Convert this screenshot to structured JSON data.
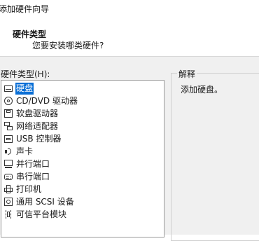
{
  "wizard": {
    "title": "添加硬件向导",
    "header_title": "硬件类型",
    "header_subtitle": "您要安装哪类硬件?"
  },
  "hardware_list": {
    "label": "硬件类型(H):",
    "selected_index": 0,
    "items": [
      {
        "label": "硬盘",
        "icon": "hard-disk-icon"
      },
      {
        "label": "CD/DVD 驱动器",
        "icon": "cd-dvd-icon"
      },
      {
        "label": "软盘驱动器",
        "icon": "floppy-icon"
      },
      {
        "label": "网络适配器",
        "icon": "network-adapter-icon"
      },
      {
        "label": "USB 控制器",
        "icon": "usb-controller-icon"
      },
      {
        "label": "声卡",
        "icon": "sound-card-icon"
      },
      {
        "label": "并行端口",
        "icon": "parallel-port-icon"
      },
      {
        "label": "串行端口",
        "icon": "serial-port-icon"
      },
      {
        "label": "打印机",
        "icon": "printer-icon"
      },
      {
        "label": "通用 SCSI 设备",
        "icon": "scsi-device-icon"
      },
      {
        "label": "可信平台模块",
        "icon": "tpm-icon"
      }
    ]
  },
  "explanation": {
    "label": "解释",
    "text": "添加硬盘。"
  }
}
